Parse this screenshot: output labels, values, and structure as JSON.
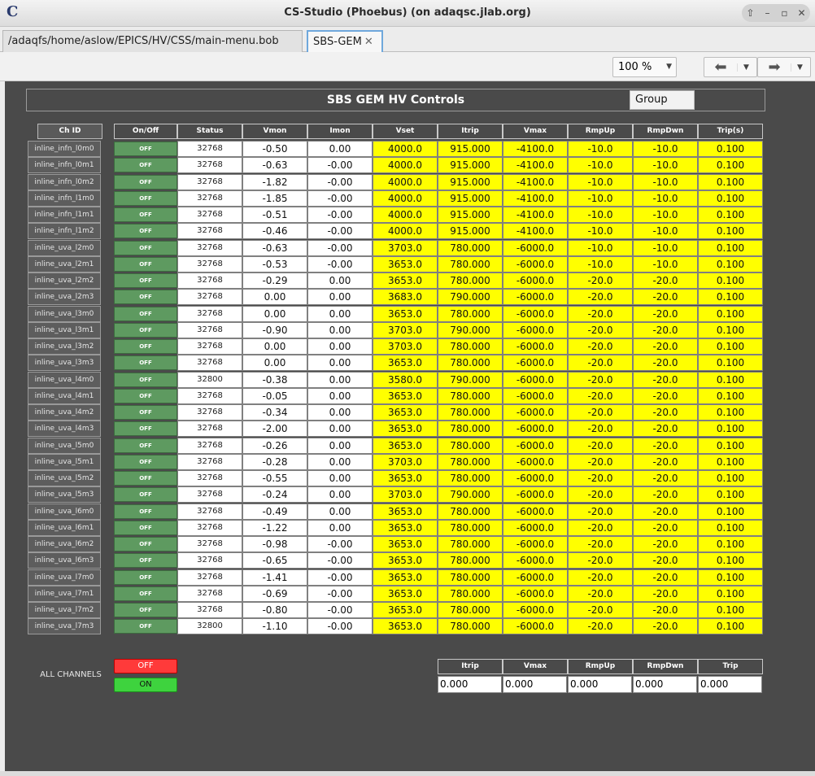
{
  "window": {
    "title": "CS-Studio (Phoebus) (on adaqsc.jlab.org)"
  },
  "tabs": [
    {
      "label": "/adaqfs/home/aslow/EPICS/HV/CSS/main-menu.bob"
    },
    {
      "label": "SBS-GEM",
      "close": "✕"
    }
  ],
  "toolbar": {
    "zoom": "100 %"
  },
  "panel": {
    "title": "SBS GEM HV Controls",
    "group_button": "Group"
  },
  "columns": [
    "Ch ID",
    "On/Off",
    "Status",
    "Vmon",
    "Imon",
    "Vset",
    "Itrip",
    "Vmax",
    "RmpUp",
    "RmpDwn",
    "Trip(s)"
  ],
  "rows": [
    {
      "id": "inline_infn_l0m0",
      "onoff": "OFF",
      "status": "32768",
      "vmon": "-0.50",
      "imon": "0.00",
      "vset": "4000.0",
      "itrip": "915.000",
      "vmax": "-4100.0",
      "rmpup": "-10.0",
      "rmpdwn": "-10.0",
      "trip": "0.100"
    },
    {
      "id": "inline_infn_l0m1",
      "onoff": "OFF",
      "status": "32768",
      "vmon": "-0.63",
      "imon": "-0.00",
      "vset": "4000.0",
      "itrip": "915.000",
      "vmax": "-4100.0",
      "rmpup": "-10.0",
      "rmpdwn": "-10.0",
      "trip": "0.100"
    },
    {
      "id": "inline_infn_l0m2",
      "onoff": "OFF",
      "status": "32768",
      "vmon": "-1.82",
      "imon": "-0.00",
      "vset": "4000.0",
      "itrip": "915.000",
      "vmax": "-4100.0",
      "rmpup": "-10.0",
      "rmpdwn": "-10.0",
      "trip": "0.100"
    },
    {
      "id": "inline_infn_l1m0",
      "onoff": "OFF",
      "status": "32768",
      "vmon": "-1.85",
      "imon": "-0.00",
      "vset": "4000.0",
      "itrip": "915.000",
      "vmax": "-4100.0",
      "rmpup": "-10.0",
      "rmpdwn": "-10.0",
      "trip": "0.100"
    },
    {
      "id": "inline_infn_l1m1",
      "onoff": "OFF",
      "status": "32768",
      "vmon": "-0.51",
      "imon": "-0.00",
      "vset": "4000.0",
      "itrip": "915.000",
      "vmax": "-4100.0",
      "rmpup": "-10.0",
      "rmpdwn": "-10.0",
      "trip": "0.100"
    },
    {
      "id": "inline_infn_l1m2",
      "onoff": "OFF",
      "status": "32768",
      "vmon": "-0.46",
      "imon": "-0.00",
      "vset": "4000.0",
      "itrip": "915.000",
      "vmax": "-4100.0",
      "rmpup": "-10.0",
      "rmpdwn": "-10.0",
      "trip": "0.100"
    },
    {
      "id": "inline_uva_l2m0",
      "onoff": "OFF",
      "status": "32768",
      "vmon": "-0.63",
      "imon": "-0.00",
      "vset": "3703.0",
      "itrip": "780.000",
      "vmax": "-6000.0",
      "rmpup": "-10.0",
      "rmpdwn": "-10.0",
      "trip": "0.100"
    },
    {
      "id": "inline_uva_l2m1",
      "onoff": "OFF",
      "status": "32768",
      "vmon": "-0.53",
      "imon": "-0.00",
      "vset": "3653.0",
      "itrip": "780.000",
      "vmax": "-6000.0",
      "rmpup": "-10.0",
      "rmpdwn": "-10.0",
      "trip": "0.100"
    },
    {
      "id": "inline_uva_l2m2",
      "onoff": "OFF",
      "status": "32768",
      "vmon": "-0.29",
      "imon": "0.00",
      "vset": "3653.0",
      "itrip": "780.000",
      "vmax": "-6000.0",
      "rmpup": "-20.0",
      "rmpdwn": "-20.0",
      "trip": "0.100"
    },
    {
      "id": "inline_uva_l2m3",
      "onoff": "OFF",
      "status": "32768",
      "vmon": "0.00",
      "imon": "0.00",
      "vset": "3683.0",
      "itrip": "790.000",
      "vmax": "-6000.0",
      "rmpup": "-20.0",
      "rmpdwn": "-20.0",
      "trip": "0.100"
    },
    {
      "id": "inline_uva_l3m0",
      "onoff": "OFF",
      "status": "32768",
      "vmon": "0.00",
      "imon": "0.00",
      "vset": "3653.0",
      "itrip": "780.000",
      "vmax": "-6000.0",
      "rmpup": "-20.0",
      "rmpdwn": "-20.0",
      "trip": "0.100"
    },
    {
      "id": "inline_uva_l3m1",
      "onoff": "OFF",
      "status": "32768",
      "vmon": "-0.90",
      "imon": "0.00",
      "vset": "3703.0",
      "itrip": "790.000",
      "vmax": "-6000.0",
      "rmpup": "-20.0",
      "rmpdwn": "-20.0",
      "trip": "0.100"
    },
    {
      "id": "inline_uva_l3m2",
      "onoff": "OFF",
      "status": "32768",
      "vmon": "0.00",
      "imon": "0.00",
      "vset": "3703.0",
      "itrip": "780.000",
      "vmax": "-6000.0",
      "rmpup": "-20.0",
      "rmpdwn": "-20.0",
      "trip": "0.100"
    },
    {
      "id": "inline_uva_l3m3",
      "onoff": "OFF",
      "status": "32768",
      "vmon": "0.00",
      "imon": "0.00",
      "vset": "3653.0",
      "itrip": "780.000",
      "vmax": "-6000.0",
      "rmpup": "-20.0",
      "rmpdwn": "-20.0",
      "trip": "0.100"
    },
    {
      "id": "inline_uva_l4m0",
      "onoff": "OFF",
      "status": "32800",
      "vmon": "-0.38",
      "imon": "0.00",
      "vset": "3580.0",
      "itrip": "790.000",
      "vmax": "-6000.0",
      "rmpup": "-20.0",
      "rmpdwn": "-20.0",
      "trip": "0.100"
    },
    {
      "id": "inline_uva_l4m1",
      "onoff": "OFF",
      "status": "32768",
      "vmon": "-0.05",
      "imon": "0.00",
      "vset": "3653.0",
      "itrip": "780.000",
      "vmax": "-6000.0",
      "rmpup": "-20.0",
      "rmpdwn": "-20.0",
      "trip": "0.100"
    },
    {
      "id": "inline_uva_l4m2",
      "onoff": "OFF",
      "status": "32768",
      "vmon": "-0.34",
      "imon": "0.00",
      "vset": "3653.0",
      "itrip": "780.000",
      "vmax": "-6000.0",
      "rmpup": "-20.0",
      "rmpdwn": "-20.0",
      "trip": "0.100"
    },
    {
      "id": "inline_uva_l4m3",
      "onoff": "OFF",
      "status": "32768",
      "vmon": "-2.00",
      "imon": "0.00",
      "vset": "3653.0",
      "itrip": "780.000",
      "vmax": "-6000.0",
      "rmpup": "-20.0",
      "rmpdwn": "-20.0",
      "trip": "0.100"
    },
    {
      "id": "inline_uva_l5m0",
      "onoff": "OFF",
      "status": "32768",
      "vmon": "-0.26",
      "imon": "0.00",
      "vset": "3653.0",
      "itrip": "780.000",
      "vmax": "-6000.0",
      "rmpup": "-20.0",
      "rmpdwn": "-20.0",
      "trip": "0.100"
    },
    {
      "id": "inline_uva_l5m1",
      "onoff": "OFF",
      "status": "32768",
      "vmon": "-0.28",
      "imon": "0.00",
      "vset": "3703.0",
      "itrip": "780.000",
      "vmax": "-6000.0",
      "rmpup": "-20.0",
      "rmpdwn": "-20.0",
      "trip": "0.100"
    },
    {
      "id": "inline_uva_l5m2",
      "onoff": "OFF",
      "status": "32768",
      "vmon": "-0.55",
      "imon": "0.00",
      "vset": "3653.0",
      "itrip": "780.000",
      "vmax": "-6000.0",
      "rmpup": "-20.0",
      "rmpdwn": "-20.0",
      "trip": "0.100"
    },
    {
      "id": "inline_uva_l5m3",
      "onoff": "OFF",
      "status": "32768",
      "vmon": "-0.24",
      "imon": "0.00",
      "vset": "3703.0",
      "itrip": "790.000",
      "vmax": "-6000.0",
      "rmpup": "-20.0",
      "rmpdwn": "-20.0",
      "trip": "0.100"
    },
    {
      "id": "inline_uva_l6m0",
      "onoff": "OFF",
      "status": "32768",
      "vmon": "-0.49",
      "imon": "0.00",
      "vset": "3653.0",
      "itrip": "780.000",
      "vmax": "-6000.0",
      "rmpup": "-20.0",
      "rmpdwn": "-20.0",
      "trip": "0.100"
    },
    {
      "id": "inline_uva_l6m1",
      "onoff": "OFF",
      "status": "32768",
      "vmon": "-1.22",
      "imon": "0.00",
      "vset": "3653.0",
      "itrip": "780.000",
      "vmax": "-6000.0",
      "rmpup": "-20.0",
      "rmpdwn": "-20.0",
      "trip": "0.100"
    },
    {
      "id": "inline_uva_l6m2",
      "onoff": "OFF",
      "status": "32768",
      "vmon": "-0.98",
      "imon": "-0.00",
      "vset": "3653.0",
      "itrip": "780.000",
      "vmax": "-6000.0",
      "rmpup": "-20.0",
      "rmpdwn": "-20.0",
      "trip": "0.100"
    },
    {
      "id": "inline_uva_l6m3",
      "onoff": "OFF",
      "status": "32768",
      "vmon": "-0.65",
      "imon": "-0.00",
      "vset": "3653.0",
      "itrip": "780.000",
      "vmax": "-6000.0",
      "rmpup": "-20.0",
      "rmpdwn": "-20.0",
      "trip": "0.100"
    },
    {
      "id": "inline_uva_l7m0",
      "onoff": "OFF",
      "status": "32768",
      "vmon": "-1.41",
      "imon": "-0.00",
      "vset": "3653.0",
      "itrip": "780.000",
      "vmax": "-6000.0",
      "rmpup": "-20.0",
      "rmpdwn": "-20.0",
      "trip": "0.100"
    },
    {
      "id": "inline_uva_l7m1",
      "onoff": "OFF",
      "status": "32768",
      "vmon": "-0.69",
      "imon": "-0.00",
      "vset": "3653.0",
      "itrip": "780.000",
      "vmax": "-6000.0",
      "rmpup": "-20.0",
      "rmpdwn": "-20.0",
      "trip": "0.100"
    },
    {
      "id": "inline_uva_l7m2",
      "onoff": "OFF",
      "status": "32768",
      "vmon": "-0.80",
      "imon": "-0.00",
      "vset": "3653.0",
      "itrip": "780.000",
      "vmax": "-6000.0",
      "rmpup": "-20.0",
      "rmpdwn": "-20.0",
      "trip": "0.100"
    },
    {
      "id": "inline_uva_l7m3",
      "onoff": "OFF",
      "status": "32800",
      "vmon": "-1.10",
      "imon": "-0.00",
      "vset": "3653.0",
      "itrip": "780.000",
      "vmax": "-6000.0",
      "rmpup": "-20.0",
      "rmpdwn": "-20.0",
      "trip": "0.100"
    }
  ],
  "all_channels": {
    "label": "ALL CHANNELS",
    "off_label": "OFF",
    "on_label": "ON",
    "headers": [
      "Itrip",
      "Vmax",
      "RmpUp",
      "RmpDwn",
      "Trip"
    ],
    "values": [
      "0.000",
      "0.000",
      "0.000",
      "0.000",
      "0.000"
    ]
  },
  "colors": {
    "background": "#4a4a4a",
    "setpoint": "#ffff00",
    "off_button": "#5e9a60",
    "all_off": "#ff3a3a",
    "all_on": "#3ed33e"
  }
}
